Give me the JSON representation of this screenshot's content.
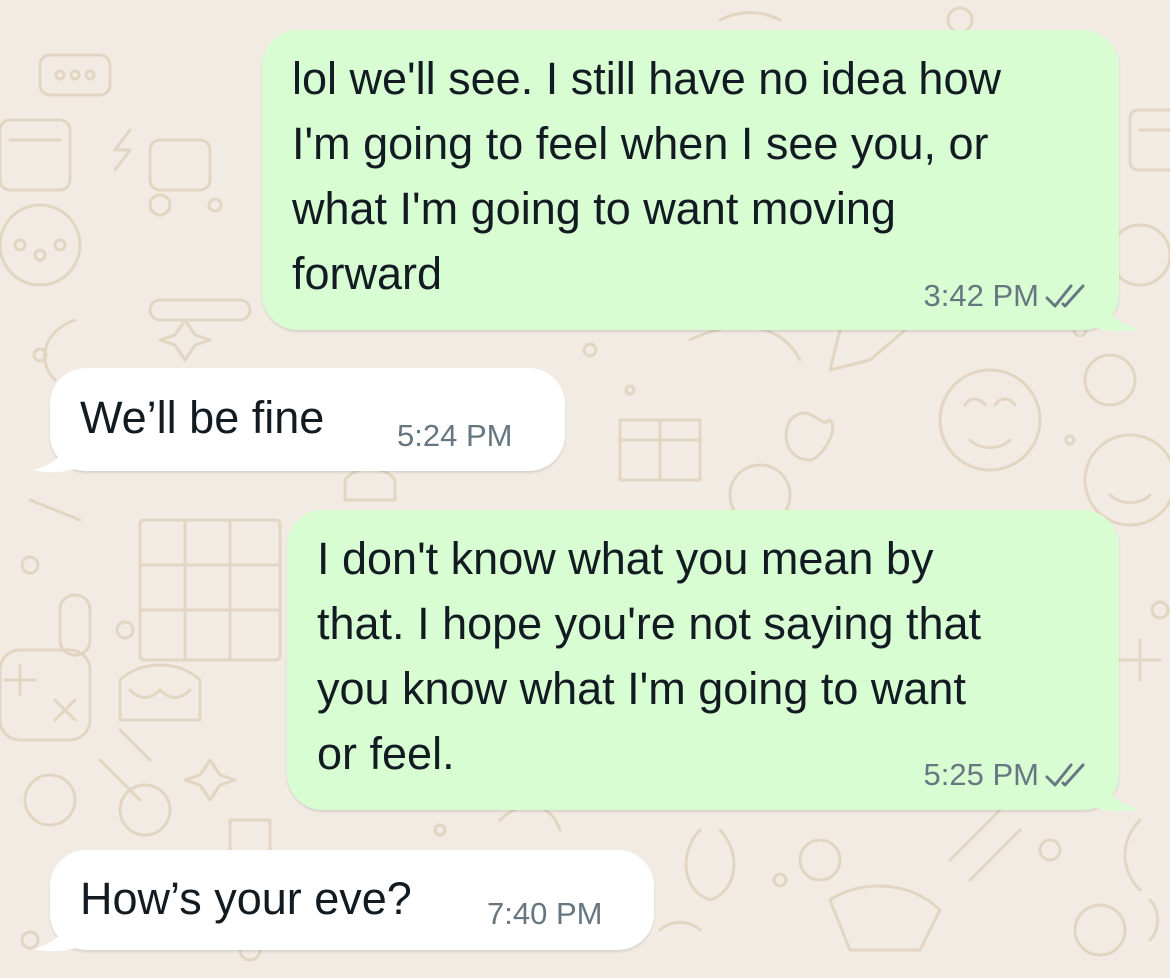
{
  "chat": {
    "messages": [
      {
        "direction": "outgoing",
        "text": "lol we'll see. I still have no idea how\nI'm going to feel when I see you, or\nwhat I'm going to want moving\nforward",
        "time": "3:42 PM",
        "status_icon": "double-check-read-icon"
      },
      {
        "direction": "incoming",
        "text": "We’ll be fine",
        "time": "5:24 PM"
      },
      {
        "direction": "outgoing",
        "text": "I don't know what you mean by\nthat. I hope you're not saying that\nyou know what I'm going to want\nor feel.",
        "time": "5:25 PM",
        "status_icon": "double-check-read-icon"
      },
      {
        "direction": "incoming",
        "text": "How’s your eve?",
        "time": "7:40 PM"
      }
    ]
  },
  "theme": {
    "wallpaper": "#f1ebe3",
    "wallpaper_doodle": "#e2d6c3",
    "outgoing_bubble": "#d9fdd3",
    "incoming_bubble": "#ffffff",
    "text": "#111b21",
    "meta_text": "#667781"
  }
}
